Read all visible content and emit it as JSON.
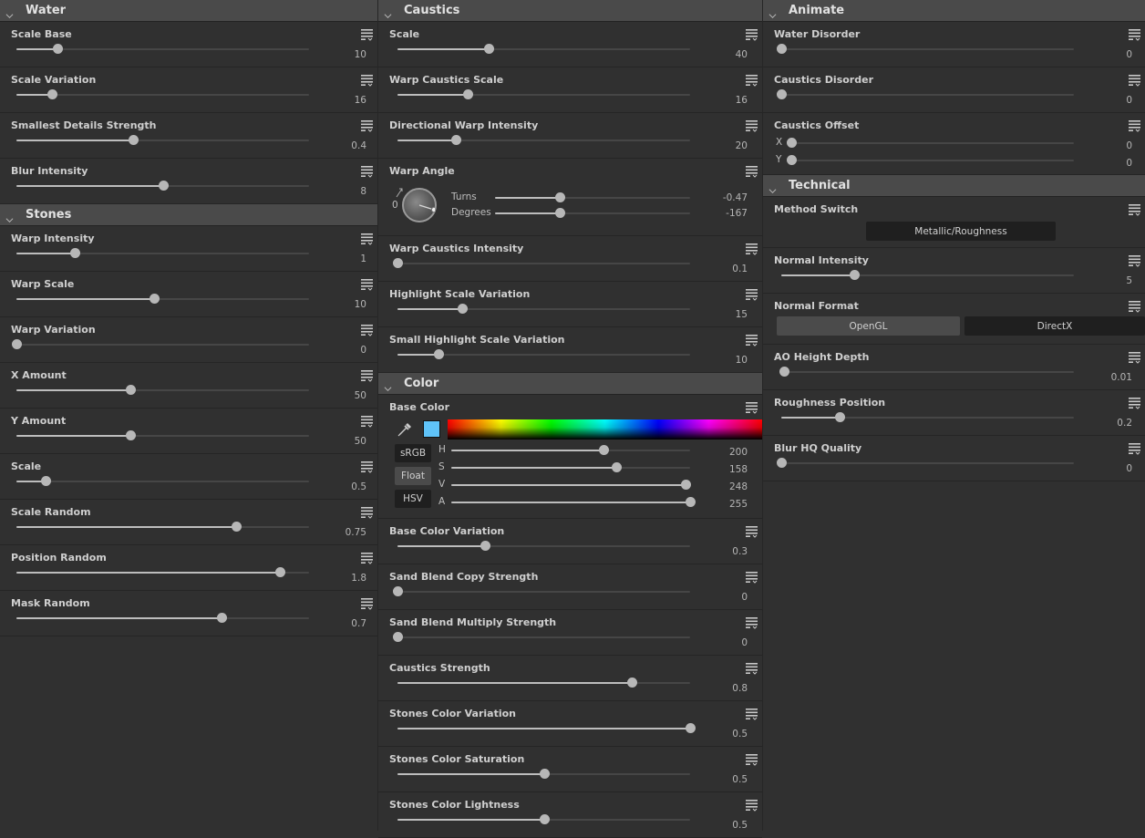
{
  "accent_colors": {
    "section_header_bg": "#4a4a4a",
    "panel_bg": "#303030",
    "slider_fill": "#bdbdbd",
    "slider_track": "#464646",
    "base_color_swatch": "#5fc3f8"
  },
  "icons": {
    "section_toggle": "chevron-down-icon",
    "param_menu": "parameter-menu-icon",
    "color_picker": "eyedropper-icon",
    "angle_widget": "angle-dial-icon"
  },
  "water": {
    "title": "Water",
    "params": [
      {
        "label": "Scale Base",
        "value": "10",
        "fraction": 0.14
      },
      {
        "label": "Scale Variation",
        "value": "16",
        "fraction": 0.12
      },
      {
        "label": "Smallest Details Strength",
        "value": "0.4",
        "fraction": 0.4
      },
      {
        "label": "Blur Intensity",
        "value": "8",
        "fraction": 0.5
      }
    ]
  },
  "stones": {
    "title": "Stones",
    "params": [
      {
        "label": "Warp Intensity",
        "value": "1",
        "fraction": 0.2
      },
      {
        "label": "Warp Scale",
        "value": "10",
        "fraction": 0.47
      },
      {
        "label": "Warp Variation",
        "value": "0",
        "fraction": 0.0
      },
      {
        "label": "X Amount",
        "value": "50",
        "fraction": 0.39
      },
      {
        "label": "Y Amount",
        "value": "50",
        "fraction": 0.39
      },
      {
        "label": "Scale",
        "value": "0.5",
        "fraction": 0.1
      },
      {
        "label": "Scale Random",
        "value": "0.75",
        "fraction": 0.75
      },
      {
        "label": "Position Random",
        "value": "1.8",
        "fraction": 0.9
      },
      {
        "label": "Mask Random",
        "value": "0.7",
        "fraction": 0.7
      }
    ]
  },
  "caustics": {
    "title": "Caustics",
    "params_top": [
      {
        "label": "Scale",
        "value": "40",
        "fraction": 0.31
      },
      {
        "label": "Warp Caustics Scale",
        "value": "16",
        "fraction": 0.24
      },
      {
        "label": "Directional Warp Intensity",
        "value": "20",
        "fraction": 0.2
      }
    ],
    "warp_angle": {
      "label": "Warp Angle",
      "dial_zero_label": "0",
      "turns_label": "Turns",
      "turns_value": "-0.47",
      "turns_fraction": 0.33,
      "degrees_label": "Degrees",
      "degrees_value": "-167",
      "degrees_fraction": 0.33
    },
    "params_bottom": [
      {
        "label": "Warp Caustics Intensity",
        "value": "0.1",
        "fraction": 0.0
      },
      {
        "label": "Highlight Scale Variation",
        "value": "15",
        "fraction": 0.22
      },
      {
        "label": "Small Highlight Scale Variation",
        "value": "10",
        "fraction": 0.14
      }
    ]
  },
  "color": {
    "title": "Color",
    "base_color": {
      "label": "Base Color",
      "swatch": "#5fc3f8",
      "mode_buttons": [
        "sRGB",
        "Float",
        "HSV"
      ],
      "active_mode": "Float",
      "channels": [
        {
          "label": "H",
          "value": "200",
          "fraction": 0.636
        },
        {
          "label": "S",
          "value": "158",
          "fraction": 0.69
        },
        {
          "label": "V",
          "value": "248",
          "fraction": 0.98
        },
        {
          "label": "A",
          "value": "255",
          "fraction": 1.0
        }
      ]
    },
    "params": [
      {
        "label": "Base Color Variation",
        "value": "0.3",
        "fraction": 0.3
      },
      {
        "label": "Sand Blend Copy Strength",
        "value": "0",
        "fraction": 0.0
      },
      {
        "label": "Sand Blend Multiply Strength",
        "value": "0",
        "fraction": 0.0
      },
      {
        "label": "Caustics Strength",
        "value": "0.8",
        "fraction": 0.8
      },
      {
        "label": "Stones Color Variation",
        "value": "0.5",
        "fraction": 1.0
      },
      {
        "label": "Stones Color Saturation",
        "value": "0.5",
        "fraction": 0.5
      },
      {
        "label": "Stones Color Lightness",
        "value": "0.5",
        "fraction": 0.5
      }
    ]
  },
  "animate": {
    "title": "Animate",
    "params": [
      {
        "label": "Water Disorder",
        "value": "0",
        "fraction": 0.0
      },
      {
        "label": "Caustics Disorder",
        "value": "0",
        "fraction": 0.0
      }
    ],
    "caustics_offset": {
      "label": "Caustics Offset",
      "x_label": "X",
      "x_value": "0",
      "x_fraction": 0.0,
      "y_label": "Y",
      "y_value": "0",
      "y_fraction": 0.0
    }
  },
  "technical": {
    "title": "Technical",
    "method_switch": {
      "label": "Method Switch",
      "value": "Metallic/Roughness"
    },
    "normal_intensity": {
      "label": "Normal Intensity",
      "value": "5",
      "fraction": 0.25
    },
    "normal_format": {
      "label": "Normal Format",
      "options": [
        "OpenGL",
        "DirectX"
      ],
      "selected": "OpenGL"
    },
    "params": [
      {
        "label": "AO Height Depth",
        "value": "0.01",
        "fraction": 0.01
      },
      {
        "label": "Roughness Position",
        "value": "0.2",
        "fraction": 0.2
      },
      {
        "label": "Blur HQ Quality",
        "value": "0",
        "fraction": 0.0
      }
    ]
  }
}
